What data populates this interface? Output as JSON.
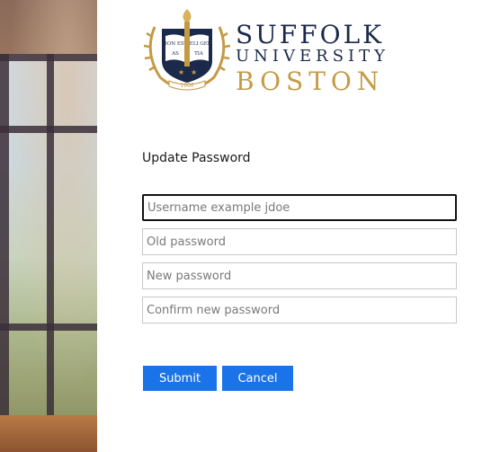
{
  "branding": {
    "seal_banner_left": "BON EST",
    "seal_banner_right": "DELI GEN",
    "seal_banner_bottom_left": "AS",
    "seal_banner_bottom_right": "TIA",
    "seal_year": "1906",
    "name_line1": "SUFFOLK",
    "name_line2": "UNIVERSITY",
    "name_line3": "BOSTON",
    "colors": {
      "navy": "#1b2a4a",
      "gold": "#c49a45"
    }
  },
  "form": {
    "title": "Update Password",
    "username_placeholder": "Username example jdoe",
    "old_password_placeholder": "Old password",
    "new_password_placeholder": "New password",
    "confirm_password_placeholder": "Confirm new password",
    "submit_label": "Submit",
    "cancel_label": "Cancel",
    "accent_color": "#1a73e8"
  }
}
